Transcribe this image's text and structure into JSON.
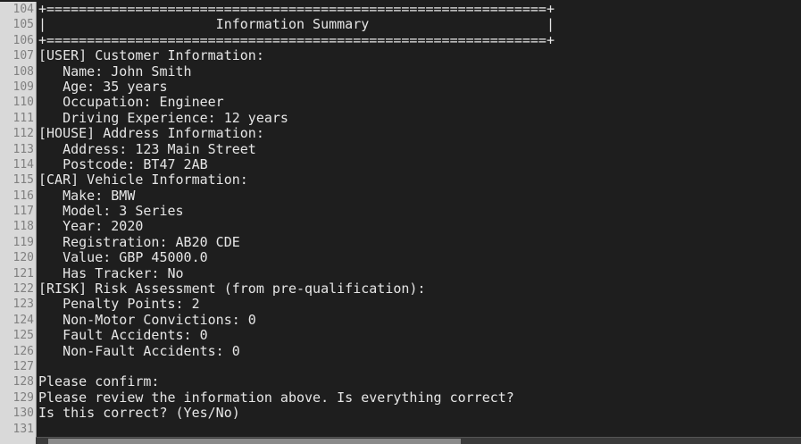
{
  "terminal": {
    "line_numbers": [
      "104",
      "105",
      "106",
      "107",
      "108",
      "109",
      "110",
      "111",
      "112",
      "113",
      "114",
      "115",
      "116",
      "117",
      "118",
      "119",
      "120",
      "121",
      "122",
      "123",
      "124",
      "125",
      "126",
      "127",
      "128",
      "129",
      "130",
      "131"
    ],
    "lines": [
      "+==============================================================+",
      "|                     Information Summary                      |",
      "+==============================================================+",
      "[USER] Customer Information:",
      "   Name: John Smith",
      "   Age: 35 years",
      "   Occupation: Engineer",
      "   Driving Experience: 12 years",
      "[HOUSE] Address Information:",
      "   Address: 123 Main Street",
      "   Postcode: BT47 2AB",
      "[CAR] Vehicle Information:",
      "   Make: BMW",
      "   Model: 3 Series",
      "   Year: 2020",
      "   Registration: AB20 CDE",
      "   Value: GBP 45000.0",
      "   Has Tracker: No",
      "[RISK] Risk Assessment (from pre-qualification):",
      "   Penalty Points: 2",
      "   Non-Motor Convictions: 0",
      "   Fault Accidents: 0",
      "   Non-Fault Accidents: 0",
      "",
      "Please confirm:",
      "Please review the information above. Is everything correct?",
      "Is this correct? (Yes/No)",
      ""
    ]
  }
}
